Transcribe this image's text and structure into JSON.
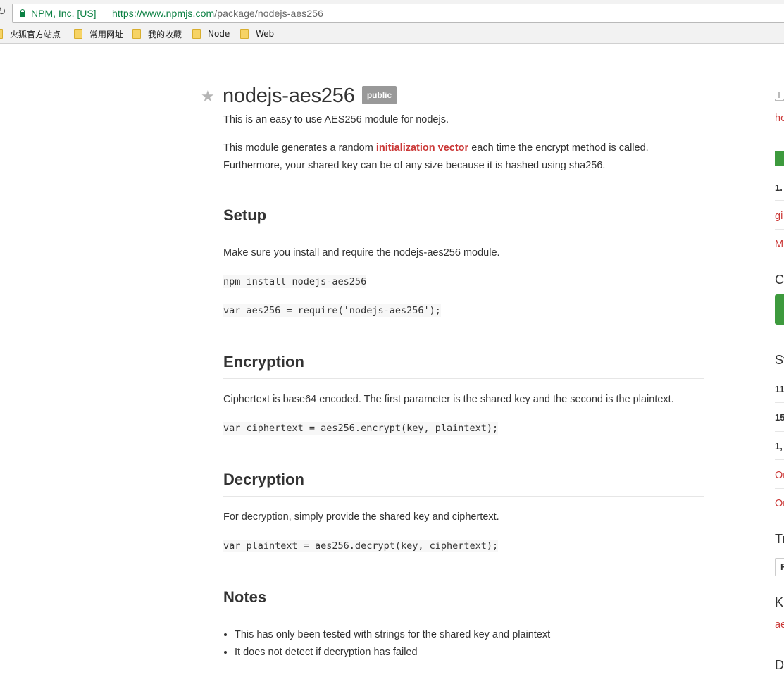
{
  "browser": {
    "site_identity": "NPM, Inc. [US]",
    "url_host": "https://www.npmjs.com",
    "url_path": "/package/nodejs-aes256",
    "bookmarks": [
      "火狐官方站点",
      "常用网址",
      "我的收藏",
      "Node",
      "Web"
    ]
  },
  "package": {
    "name": "nodejs-aes256",
    "badge": "public",
    "description": "This is an easy to use AES256 module for nodejs.",
    "intro_before": "This module generates a random ",
    "intro_link": "initialization vector",
    "intro_after": " each time the encrypt method is called. Furthermore, your shared key can be of any size because it is hashed using sha256."
  },
  "readme": {
    "setup": {
      "heading": "Setup",
      "text": "Make sure you install and require the nodejs-aes256 module.",
      "code1": "npm install nodejs-aes256",
      "code2": "var aes256 = require('nodejs-aes256');"
    },
    "encryption": {
      "heading": "Encryption",
      "text": "Ciphertext is base64 encoded. The first parameter is the shared key and the second is the plaintext.",
      "code": "var ciphertext = aes256.encrypt(key, plaintext);"
    },
    "decryption": {
      "heading": "Decryption",
      "text": "For decryption, simply provide the shared key and ciphertext.",
      "code": "var plaintext = aes256.decrypt(key, ciphertext);"
    },
    "notes": {
      "heading": "Notes",
      "items": [
        "This has only been tested with strings for the shared key and plaintext",
        "It does not detect if decryption has failed"
      ]
    }
  },
  "sidebar_fragments": {
    "install_link": "ho",
    "version": "1.",
    "repo_link": "gi",
    "license_link": "M",
    "collab_heading": "C",
    "stats_heading": "St",
    "stat1": "11",
    "stat2": "15",
    "stat3": "1,",
    "open_issues": "Or",
    "open_prs": "Or",
    "try_heading": "Tr",
    "try_input": "R",
    "keywords_heading": "K",
    "keyword1": "ae",
    "deps_heading": "D"
  },
  "colors": {
    "npm_red": "#cb3837",
    "secure_green": "#0b8043",
    "badge_gray": "#999999"
  }
}
